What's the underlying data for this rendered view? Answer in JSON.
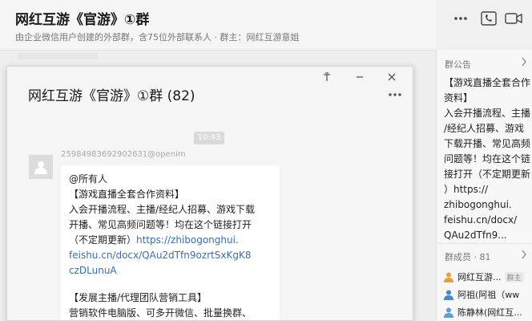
{
  "header": {
    "title": "网红互游《官游》①群",
    "subtitle": "由企业微信用户创建的外部群，含75位外部联系人 · 群主：网红互游意姐"
  },
  "popup": {
    "title": "网红互游《官游》①群 (82)",
    "time": "10:43",
    "sender": "25984983692902631@openim",
    "message": {
      "lines_a": [
        "@所有人",
        "【游戏直播全套合作资料】",
        "入会开播流程、主播/经纪人招募、游戏下载",
        "开播、常见高频问题等！均在这个链接打开"
      ],
      "link_prefix": "（不定期更新）",
      "link_lines": [
        "https://zhibogonghui.",
        "feishu.cn/docx/QAu2dTfn9ozrtSxKgK8",
        "czDLunuA"
      ],
      "lines_b": [
        "【发展主播/代理团队营销工具】",
        "营销软件电脑版、可多开微信、批量换群、"
      ]
    }
  },
  "sidebar": {
    "notice_title": "群公告",
    "notice_lines": [
      "【游戏直播全套合作",
      "资料】",
      "入会开播流程、主播",
      "/经纪人招募、游戏",
      "下载开播、常见高频",
      "问题等！均在这个链",
      "接打开（不定期更新",
      "）https://",
      "zhibogonghui.",
      "feishu.cn/docx/",
      "QAu2dTfn9..."
    ],
    "members_title": "群成员 · 81",
    "members": [
      {
        "name": "网红互游...",
        "tag": "群主",
        "color": "#e8a03a"
      },
      {
        "name": "阿祖(阿祖（ww",
        "tag": "",
        "color": "#4a86c8"
      },
      {
        "name": "陈静林(网红互...",
        "tag": "",
        "color": "#5aa0d8"
      }
    ]
  },
  "colors": {
    "link": "#3b6db3",
    "owner_icon": "#e8a03a"
  }
}
